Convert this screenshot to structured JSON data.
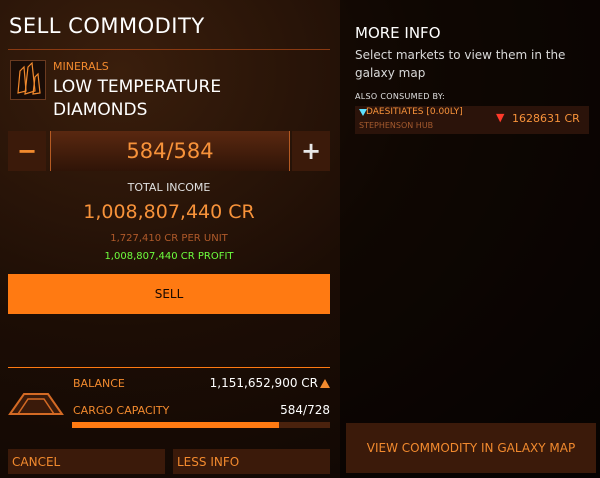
{
  "header": {
    "title": "SELL COMMODITY"
  },
  "commodity": {
    "category": "MINERALS",
    "name_line1": "LOW TEMPERATURE",
    "name_line2": "DIAMONDS",
    "icon": "crystal-icon"
  },
  "quantity": {
    "minus_label": "−",
    "plus_label": "+",
    "value": "584/584"
  },
  "income": {
    "label": "TOTAL INCOME",
    "total": "1,008,807,440 CR",
    "per_unit": "1,727,410 CR PER UNIT",
    "profit": "1,008,807,440 CR PROFIT"
  },
  "sell_button": "SELL",
  "ship": {
    "icon": "ship-icon",
    "balance_label": "BALANCE",
    "balance_value": "1,151,652,900 CR",
    "cargo_label": "CARGO CAPACITY",
    "cargo_value": "584/728",
    "cargo_fill_fraction": 0.802
  },
  "actions": {
    "cancel": "CANCEL",
    "less_info": "LESS INFO"
  },
  "more_info": {
    "title": "MORE INFO",
    "description": "Select markets to view them in the galaxy map",
    "also_consumed_label": "ALSO CONSUMED BY:",
    "markets": [
      {
        "name": "DAESITIATES [0.00LY]",
        "station": "STEPHENSON HUB",
        "price": "1628631 CR",
        "trend": "down-arrow-icon"
      }
    ]
  },
  "view_galaxy_button": "VIEW COMMODITY IN GALAXY MAP",
  "colors": {
    "accent": "#ff7a12",
    "text_orange": "#f28a2e",
    "profit_green": "#6dff3e",
    "price_down_red": "#ff3a2a",
    "market_marker_cyan": "#5ee0ff"
  }
}
